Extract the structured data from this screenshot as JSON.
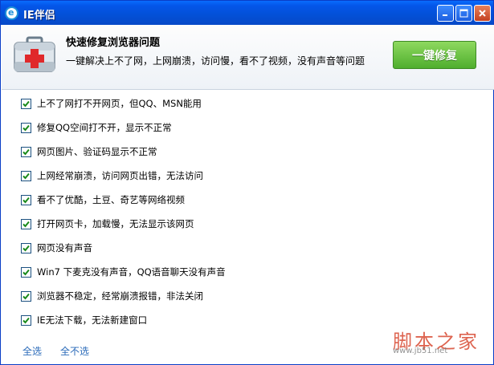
{
  "window": {
    "title": "IE伴侣",
    "title_icon_letter": "e",
    "controls": [
      "minimize-icon",
      "maximize-icon",
      "close-icon"
    ]
  },
  "header": {
    "title": "快速修复浏览器问题",
    "description": "一键解决上不了网，上网崩溃，访问慢，看不了视频，没有声音等问题",
    "fix_button": "一键修复",
    "icon": "medical-kit-icon"
  },
  "items": [
    {
      "label": "上不了网打不开网页，但QQ、MSN能用",
      "checked": true
    },
    {
      "label": "修复QQ空间打不开，显示不正常",
      "checked": true
    },
    {
      "label": "网页图片、验证码显示不正常",
      "checked": true
    },
    {
      "label": "上网经常崩溃，访问网页出错，无法访问",
      "checked": true
    },
    {
      "label": "看不了优酷，土豆、奇艺等网络视频",
      "checked": true
    },
    {
      "label": "打开网页卡，加载慢，无法显示该网页",
      "checked": true
    },
    {
      "label": "网页没有声音",
      "checked": true
    },
    {
      "label": "Win7 下麦克没有声音，QQ语音聊天没有声音",
      "checked": true
    },
    {
      "label": "浏览器不稳定，经常崩溃报错，非法关闭",
      "checked": true
    },
    {
      "label": "IE无法下载，无法新建窗口",
      "checked": true
    }
  ],
  "footer": {
    "select_all": "全选",
    "select_none": "全不选"
  },
  "watermark": {
    "brand": "脚本之家",
    "url": "www.jb51.net"
  },
  "colors": {
    "titlebar": "#0350d7",
    "fix_button": "#4fae2e",
    "link": "#2a6ab9",
    "checkmark": "#1a8a1a"
  }
}
